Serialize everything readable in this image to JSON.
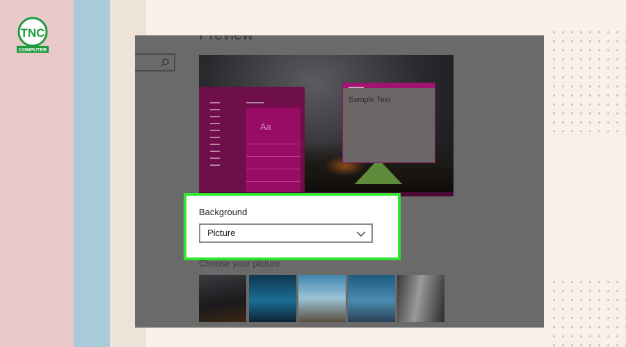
{
  "brand": {
    "logo_text": "TNC",
    "logo_subtext": "COMPUTER"
  },
  "settings": {
    "preview_title": "Preview",
    "preview_tile_label": "Aa",
    "preview_window_text": "Sample Text",
    "background_label": "Background",
    "background_value": "Picture",
    "choose_picture_label": "Choose your picture"
  },
  "colors": {
    "highlight": "#2ee62e",
    "accent_magenta": "#990c66",
    "overlay_gray": "#6a6a6a"
  },
  "icons": {
    "search": "search-icon",
    "dropdown": "chevron-down-icon"
  }
}
